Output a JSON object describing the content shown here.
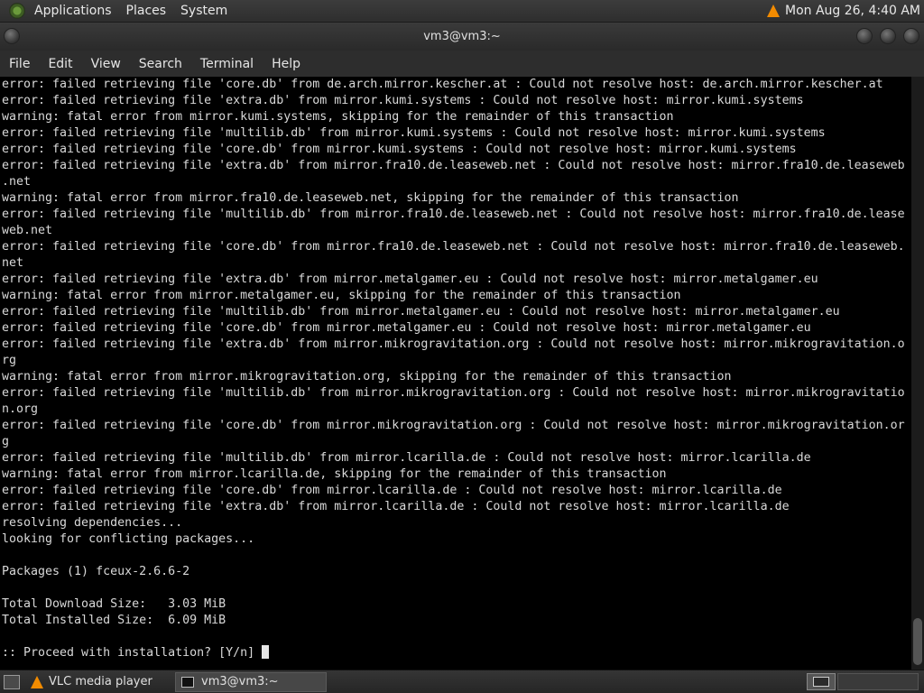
{
  "top_panel": {
    "menus": [
      "Applications",
      "Places",
      "System"
    ],
    "clock": "Mon Aug 26,  4:40 AM",
    "tray_icon": "vlc-cone-icon"
  },
  "window": {
    "title": "vm3@vm3:~"
  },
  "menubar": {
    "items": [
      "File",
      "Edit",
      "View",
      "Search",
      "Terminal",
      "Help"
    ]
  },
  "terminal": {
    "lines": [
      "error: failed retrieving file 'core.db' from de.arch.mirror.kescher.at : Could not resolve host: de.arch.mirror.kescher.at",
      "error: failed retrieving file 'extra.db' from mirror.kumi.systems : Could not resolve host: mirror.kumi.systems",
      "warning: fatal error from mirror.kumi.systems, skipping for the remainder of this transaction",
      "error: failed retrieving file 'multilib.db' from mirror.kumi.systems : Could not resolve host: mirror.kumi.systems",
      "error: failed retrieving file 'core.db' from mirror.kumi.systems : Could not resolve host: mirror.kumi.systems",
      "error: failed retrieving file 'extra.db' from mirror.fra10.de.leaseweb.net : Could not resolve host: mirror.fra10.de.leaseweb",
      ".net",
      "warning: fatal error from mirror.fra10.de.leaseweb.net, skipping for the remainder of this transaction",
      "error: failed retrieving file 'multilib.db' from mirror.fra10.de.leaseweb.net : Could not resolve host: mirror.fra10.de.lease",
      "web.net",
      "error: failed retrieving file 'core.db' from mirror.fra10.de.leaseweb.net : Could not resolve host: mirror.fra10.de.leaseweb.",
      "net",
      "error: failed retrieving file 'extra.db' from mirror.metalgamer.eu : Could not resolve host: mirror.metalgamer.eu",
      "warning: fatal error from mirror.metalgamer.eu, skipping for the remainder of this transaction",
      "error: failed retrieving file 'multilib.db' from mirror.metalgamer.eu : Could not resolve host: mirror.metalgamer.eu",
      "error: failed retrieving file 'core.db' from mirror.metalgamer.eu : Could not resolve host: mirror.metalgamer.eu",
      "error: failed retrieving file 'extra.db' from mirror.mikrogravitation.org : Could not resolve host: mirror.mikrogravitation.o",
      "rg",
      "warning: fatal error from mirror.mikrogravitation.org, skipping for the remainder of this transaction",
      "error: failed retrieving file 'multilib.db' from mirror.mikrogravitation.org : Could not resolve host: mirror.mikrogravitatio",
      "n.org",
      "error: failed retrieving file 'core.db' from mirror.mikrogravitation.org : Could not resolve host: mirror.mikrogravitation.or",
      "g",
      "error: failed retrieving file 'multilib.db' from mirror.lcarilla.de : Could not resolve host: mirror.lcarilla.de",
      "warning: fatal error from mirror.lcarilla.de, skipping for the remainder of this transaction",
      "error: failed retrieving file 'core.db' from mirror.lcarilla.de : Could not resolve host: mirror.lcarilla.de",
      "error: failed retrieving file 'extra.db' from mirror.lcarilla.de : Could not resolve host: mirror.lcarilla.de",
      "resolving dependencies...",
      "looking for conflicting packages...",
      "",
      "Packages (1) fceux-2.6.6-2",
      "",
      "Total Download Size:   3.03 MiB",
      "Total Installed Size:  6.09 MiB",
      ""
    ],
    "prompt": ":: Proceed with installation? [Y/n] "
  },
  "bottom_panel": {
    "tasks": [
      {
        "label": "VLC media player",
        "icon": "vlc-cone-icon"
      },
      {
        "label": "vm3@vm3:~",
        "icon": "terminal-icon"
      }
    ]
  }
}
